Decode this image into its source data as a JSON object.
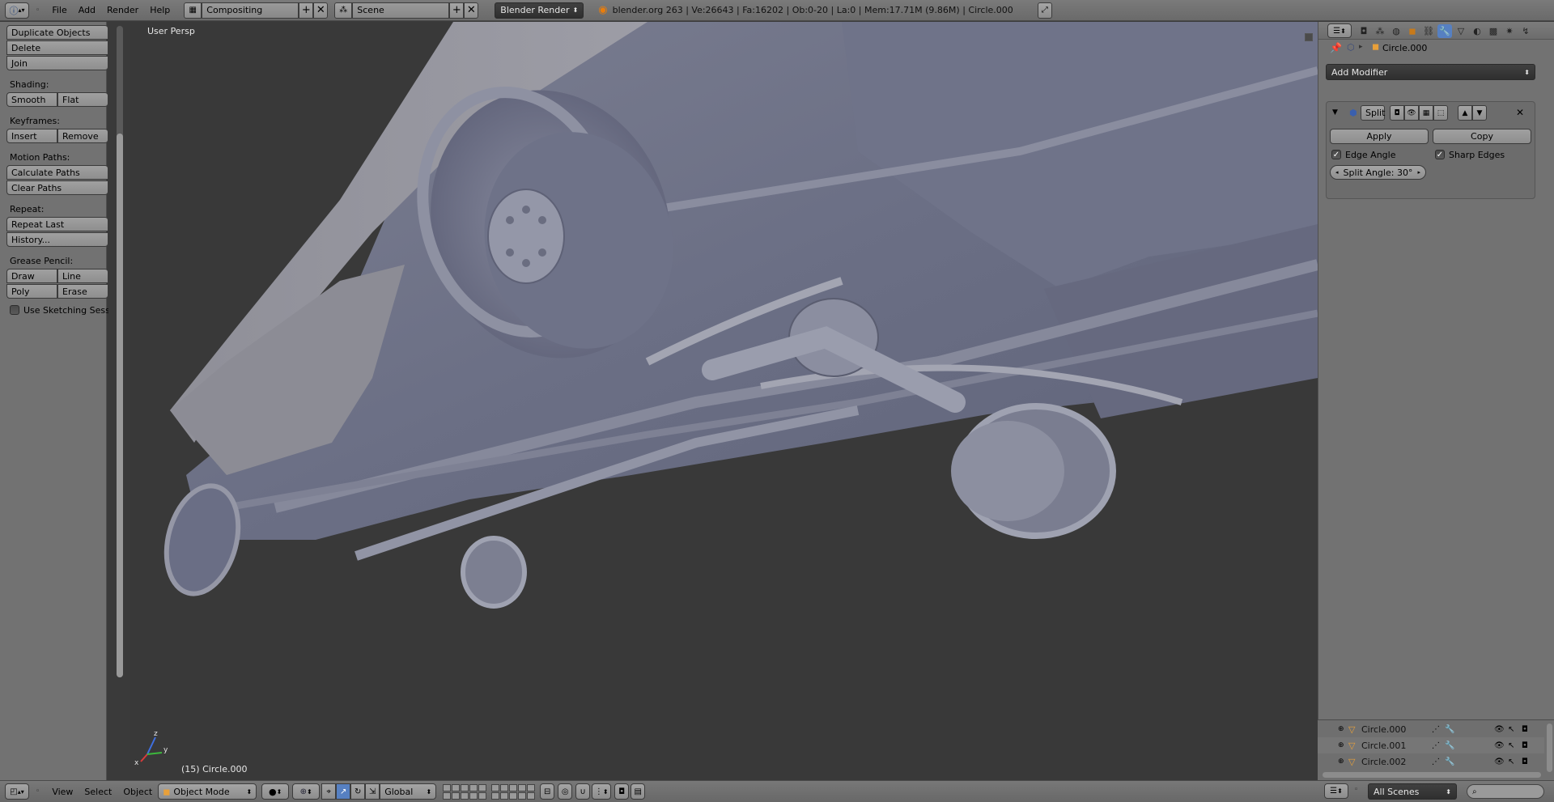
{
  "top_header": {
    "menus": [
      "File",
      "Add",
      "Render",
      "Help"
    ],
    "screen_layout": "Compositing",
    "scene": "Scene",
    "render_engine": "Blender Render",
    "stats": "blender.org 263 | Ve:26643 | Fa:16202 | Ob:0-20 | La:0 | Mem:17.71M (9.86M) | Circle.000"
  },
  "toolshelf": {
    "object_buttons": [
      "Duplicate Objects",
      "Delete",
      "Join"
    ],
    "shading_label": "Shading:",
    "shading_buttons": [
      "Smooth",
      "Flat"
    ],
    "keyframes_label": "Keyframes:",
    "keyframe_buttons": [
      "Insert",
      "Remove"
    ],
    "motion_paths_label": "Motion Paths:",
    "motion_path_buttons": [
      "Calculate Paths",
      "Clear Paths"
    ],
    "repeat_label": "Repeat:",
    "repeat_buttons": [
      "Repeat Last",
      "History..."
    ],
    "grease_pencil_label": "Grease Pencil:",
    "grease_buttons": [
      "Draw",
      "Line",
      "Poly",
      "Erase"
    ],
    "sketching_checkbox": "Use Sketching Sessio"
  },
  "viewport": {
    "view_name": "User Persp",
    "object_info": "(15) Circle.000",
    "axes": {
      "x": "x",
      "y": "y",
      "z": "z"
    }
  },
  "viewport_header": {
    "menus": [
      "View",
      "Select",
      "Object"
    ],
    "mode": "Object Mode",
    "orientation": "Global"
  },
  "properties": {
    "object_name": "Circle.000",
    "add_modifier": "Add Modifier",
    "modifier": {
      "name": "Split",
      "apply": "Apply",
      "copy": "Copy",
      "edge_angle": "Edge Angle",
      "sharp_edges": "Sharp Edges",
      "edge_angle_checked": true,
      "sharp_edges_checked": true,
      "split_angle": "Split Angle: 30°"
    }
  },
  "outliner": {
    "rows": [
      "Circle.000",
      "Circle.001",
      "Circle.002"
    ],
    "scene_filter": "All Scenes"
  },
  "colors": {
    "accent_blue": "#5680c2",
    "viewport_bg": "#393939",
    "panel_bg": "#727272",
    "mesh": "#6a6f86"
  }
}
